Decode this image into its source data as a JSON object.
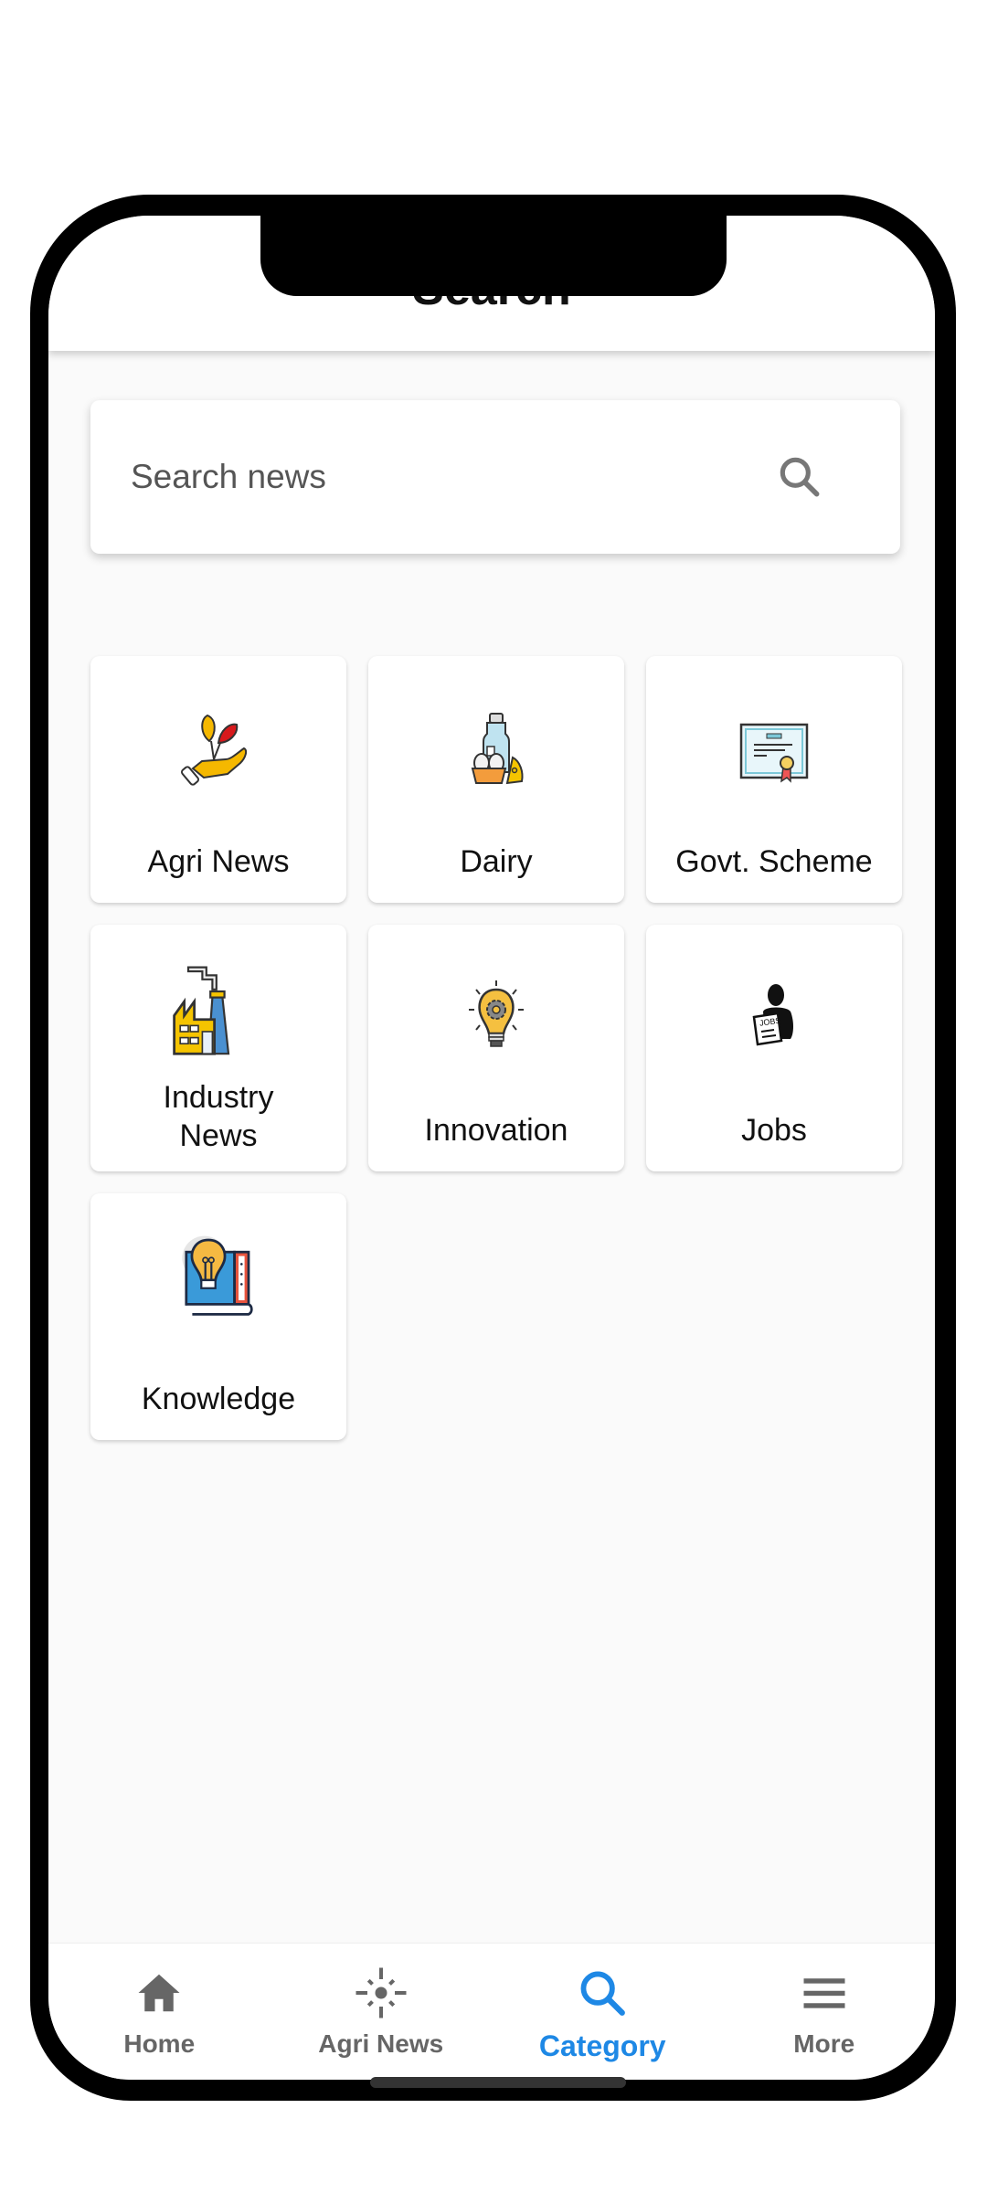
{
  "appbar": {
    "title": "Search"
  },
  "search": {
    "placeholder": "Search news",
    "value": "",
    "icon": "search-icon"
  },
  "categories": [
    {
      "label": "Agri News",
      "icon": "plant-in-hand-icon"
    },
    {
      "label": "Dairy",
      "icon": "dairy-products-icon"
    },
    {
      "label": "Govt. Scheme",
      "icon": "certificate-icon"
    },
    {
      "label": "Industry News",
      "icon": "factory-icon"
    },
    {
      "label": "Innovation",
      "icon": "lightbulb-gear-icon"
    },
    {
      "label": "Jobs",
      "icon": "person-jobs-paper-icon"
    },
    {
      "label": "Knowledge",
      "icon": "book-lightbulb-icon"
    }
  ],
  "bottom_nav": {
    "active_color": "#1e88e5",
    "inactive_color": "#666666",
    "items": [
      {
        "label": "Home",
        "icon": "home-icon",
        "active": false
      },
      {
        "label": "Agri News",
        "icon": "sun-icon",
        "active": false
      },
      {
        "label": "Category",
        "icon": "search-icon",
        "active": true
      },
      {
        "label": "More",
        "icon": "menu-icon",
        "active": false
      }
    ]
  }
}
